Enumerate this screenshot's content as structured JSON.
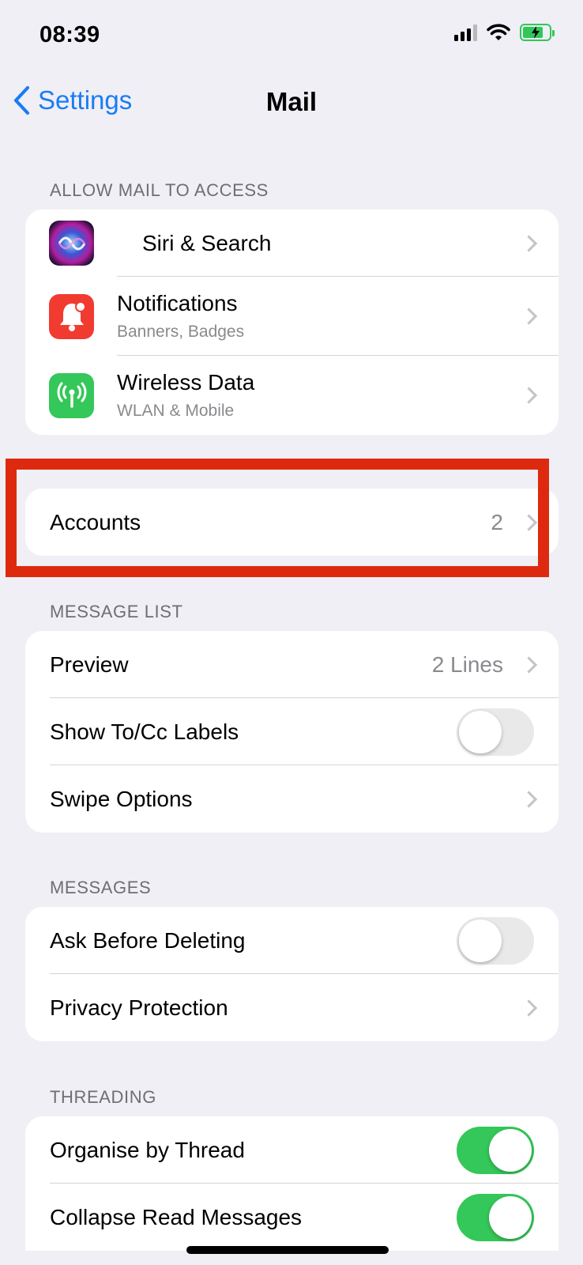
{
  "status_bar": {
    "time": "08:39",
    "battery_level": 0.8,
    "battery_color": "#30c759"
  },
  "nav": {
    "back_label": "Settings",
    "title": "Mail"
  },
  "sections": {
    "access": {
      "header": "ALLOW MAIL TO ACCESS",
      "rows": [
        {
          "label": "Siri & Search",
          "icon": "siri-icon"
        },
        {
          "label": "Notifications",
          "sublabel": "Banners, Badges",
          "icon": "bell-icon",
          "icon_color": "#f23b30"
        },
        {
          "label": "Wireless Data",
          "sublabel": "WLAN & Mobile",
          "icon": "antenna-icon",
          "icon_color": "#34c759"
        }
      ]
    },
    "accounts": {
      "label": "Accounts",
      "value": "2"
    },
    "message_list": {
      "header": "MESSAGE LIST",
      "rows": [
        {
          "label": "Preview",
          "value": "2 Lines"
        },
        {
          "label": "Show To/Cc Labels",
          "toggle": false
        },
        {
          "label": "Swipe Options"
        }
      ]
    },
    "messages": {
      "header": "MESSAGES",
      "rows": [
        {
          "label": "Ask Before Deleting",
          "toggle": false
        },
        {
          "label": "Privacy Protection"
        }
      ]
    },
    "threading": {
      "header": "THREADING",
      "rows": [
        {
          "label": "Organise by Thread",
          "toggle": true
        },
        {
          "label": "Collapse Read Messages",
          "toggle": true
        }
      ]
    }
  },
  "colors": {
    "accent": "#1a7cf5",
    "toggle_on": "#34c759",
    "highlight": "#dd2a0f",
    "background": "#f0eff5"
  }
}
